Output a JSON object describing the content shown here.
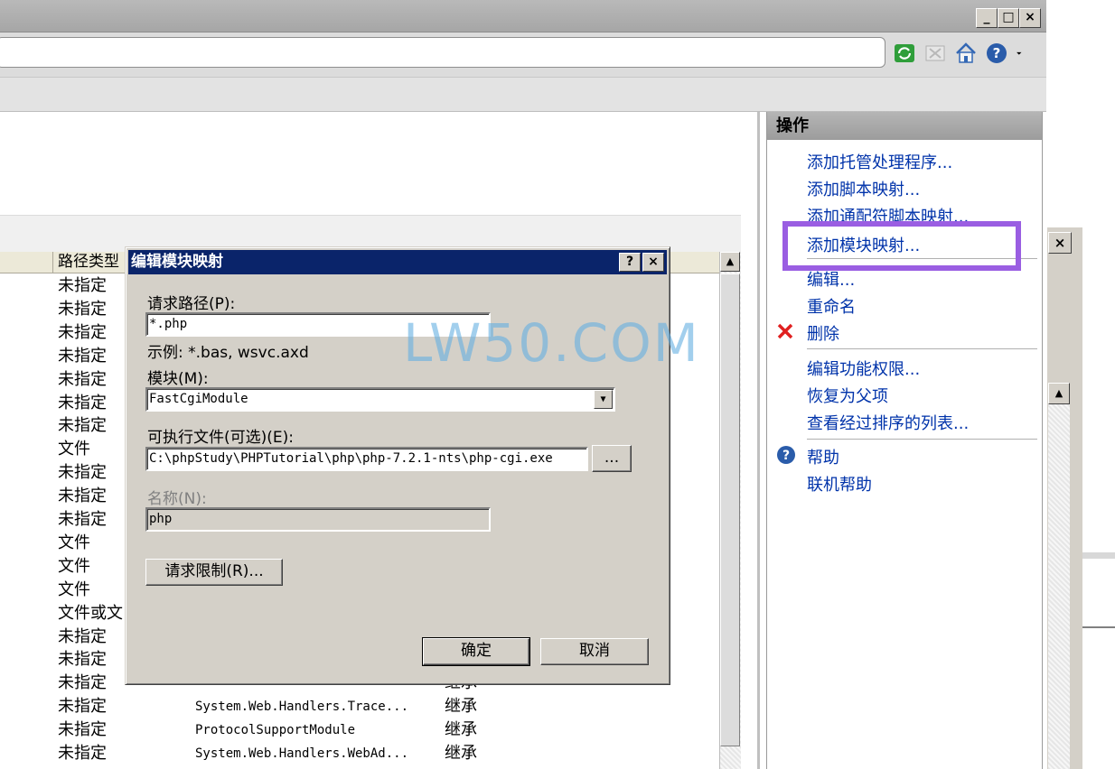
{
  "window": {
    "min": "_",
    "max": "□",
    "close": "×"
  },
  "list": {
    "header_path_type": "路径类型",
    "rows": [
      {
        "path_type": "未指定",
        "handler": "",
        "state": ""
      },
      {
        "path_type": "未指定",
        "handler": "",
        "state": ""
      },
      {
        "path_type": "未指定",
        "handler": "",
        "state": ""
      },
      {
        "path_type": "未指定",
        "handler": "",
        "state": ""
      },
      {
        "path_type": "未指定",
        "handler": "",
        "state": ""
      },
      {
        "path_type": "未指定",
        "handler": "",
        "state": ""
      },
      {
        "path_type": "未指定",
        "handler": "",
        "state": ""
      },
      {
        "path_type": "文件",
        "handler": "",
        "state": ""
      },
      {
        "path_type": "未指定",
        "handler": "",
        "state": ""
      },
      {
        "path_type": "未指定",
        "handler": "",
        "state": ""
      },
      {
        "path_type": "未指定",
        "handler": "",
        "state": ""
      },
      {
        "path_type": "文件",
        "handler": "",
        "state": ""
      },
      {
        "path_type": "文件",
        "handler": "",
        "state": ""
      },
      {
        "path_type": "文件",
        "handler": "",
        "state": ""
      },
      {
        "path_type": "文件或文",
        "handler": "",
        "state": ""
      },
      {
        "path_type": "未指定",
        "handler": "",
        "state": ""
      },
      {
        "path_type": "未指定",
        "handler": "",
        "state": ""
      },
      {
        "path_type": "未指定",
        "handler": "",
        "state": "继承"
      },
      {
        "path_type": "未指定",
        "handler": "System.Web.Handlers.Trace...",
        "state": "继承"
      },
      {
        "path_type": "未指定",
        "handler": "ProtocolSupportModule",
        "state": "继承"
      },
      {
        "path_type": "未指定",
        "handler": "System.Web.Handlers.WebAd...",
        "state": "继承"
      }
    ]
  },
  "actions": {
    "title": "操作",
    "add_managed": "添加托管处理程序...",
    "add_script": "添加脚本映射...",
    "add_wildcard": "添加通配符脚本映射...",
    "add_module": "添加模块映射...",
    "edit": "编辑...",
    "rename": "重命名",
    "delete": "删除",
    "edit_permissions": "编辑功能权限...",
    "revert": "恢复为父项",
    "view_ordered": "查看经过排序的列表...",
    "help": "帮助",
    "online_help": "联机帮助"
  },
  "dialog": {
    "title": "编辑模块映射",
    "help_btn": "?",
    "close_btn": "×",
    "request_path_label": "请求路径(P):",
    "request_path_value": "*.php",
    "example": "示例: *.bas, wsvc.axd",
    "module_label": "模块(M):",
    "module_value": "FastCgiModule",
    "executable_label": "可执行文件(可选)(E):",
    "executable_value": "C:\\phpStudy\\PHPTutorial\\php\\php-7.2.1-nts\\php-cgi.exe",
    "browse_btn": "...",
    "name_label": "名称(N):",
    "name_value": "php",
    "restrictions_btn": "请求限制(R)...",
    "ok_btn": "确定",
    "cancel_btn": "取消"
  },
  "watermark": "LW50.COM",
  "colors": {
    "highlight": "#9a5ee2",
    "dialog_title": "#0a246a",
    "delete": "#e02020",
    "help": "#2a5caa"
  }
}
